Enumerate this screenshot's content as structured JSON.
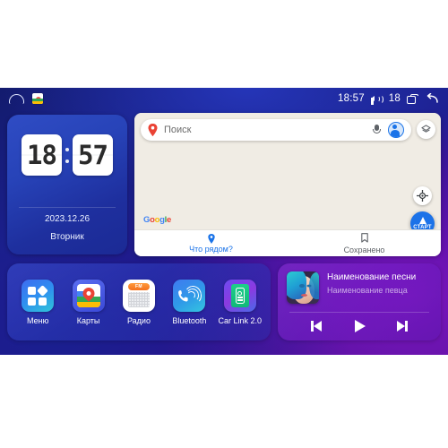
{
  "statusbar": {
    "home_icon": "home-icon",
    "maps_icon": "maps-app-icon",
    "time": "18:57",
    "volume_icon": "volume-icon",
    "volume_level": "18",
    "recents_icon": "recent-apps-icon",
    "back_icon": "back-icon"
  },
  "clock_widget": {
    "hours": "18",
    "minutes": "57",
    "date": "2023.12.26",
    "weekday": "Вторник"
  },
  "maps_widget": {
    "search": {
      "placeholder": "Поиск",
      "pin_icon": "map-pin-icon",
      "mic_icon": "microphone-icon",
      "avatar_icon": "account-avatar-icon"
    },
    "layers_icon": "layers-button-icon",
    "locate_icon": "my-location-icon",
    "start_button": "СТАРТ",
    "watermark": "Google",
    "tabs": [
      {
        "label": "Что рядом?",
        "icon": "location-pin-icon",
        "active": true
      },
      {
        "label": "Сохранено",
        "icon": "bookmark-icon",
        "active": false
      }
    ]
  },
  "dock": {
    "apps": [
      {
        "label": "Меню",
        "icon": "menu-grid-icon"
      },
      {
        "label": "Карты",
        "icon": "google-maps-icon"
      },
      {
        "label": "Радио",
        "icon": "radio-icon",
        "badge": "FM"
      },
      {
        "label": "Bluetooth",
        "icon": "bluetooth-phone-icon"
      },
      {
        "label": "Car Link 2.0",
        "icon": "car-link-icon"
      }
    ]
  },
  "music_widget": {
    "album_art": "album-cover-portrait",
    "title": "Наименование песни",
    "artist": "Наименование певца",
    "controls": [
      {
        "name": "previous-track",
        "icon": "skip-previous-icon"
      },
      {
        "name": "play",
        "icon": "play-icon"
      },
      {
        "name": "next-track",
        "icon": "skip-next-icon"
      }
    ]
  },
  "colors": {
    "bg_blue": "#1b1f8c",
    "bg_purple": "#4a108f",
    "map_bg": "#f2efe9",
    "accent_blue": "#1a73e8",
    "start_blue": "#1b72e8"
  }
}
